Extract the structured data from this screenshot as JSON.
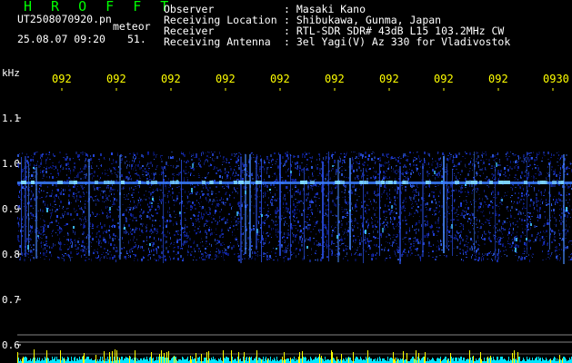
{
  "header": {
    "app_title": "H R O F F T",
    "filename": "UT2508070920.pn",
    "suffix": "meteor",
    "datetime": "25.08.07 09:20",
    "count": "51.",
    "info": [
      {
        "label": "Observer",
        "value": ": Masaki Kano"
      },
      {
        "label": "Receiving Location",
        "value": ": Shibukawa, Gunma, Japan"
      },
      {
        "label": "Receiver",
        "value": ": RTL-SDR SDR# 43dB L15 103.2MHz CW"
      },
      {
        "label": "Receiving Antenna",
        "value": ": 3el Yagi(V) Az 330 for Vladivostok"
      }
    ]
  },
  "axis": {
    "unit": "kHz",
    "freq_labels": [
      "1.1",
      "1.0",
      "0.9",
      "0.8",
      "0.7",
      "0.6"
    ],
    "time_labels": [
      "092",
      "092",
      "092",
      "092",
      "092",
      "092",
      "092",
      "092",
      "092",
      "0930"
    ]
  },
  "colors": {
    "background": "#000000",
    "title": "#00ff00",
    "text": "#ffffff",
    "time_labels": "#ffff00",
    "signal": "#2a3cff",
    "baseline_cyan": "#00e5ff",
    "baseline_yellow": "#ffff00"
  }
}
